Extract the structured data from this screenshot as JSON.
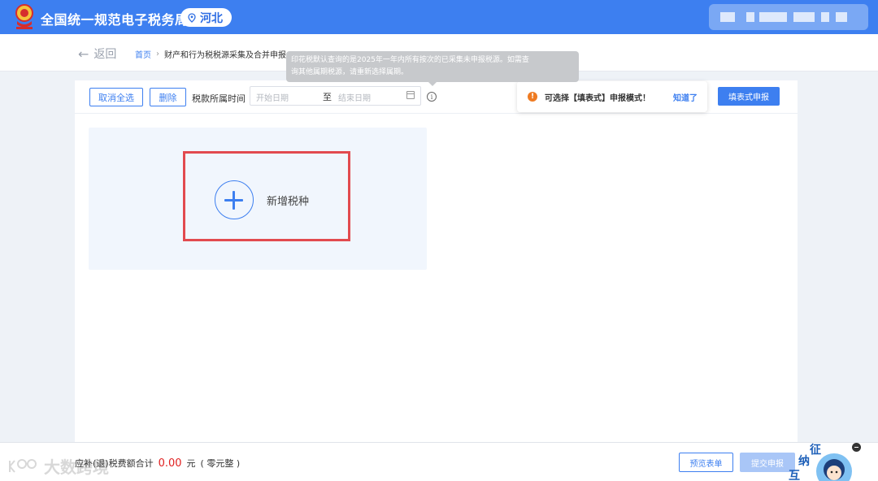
{
  "header": {
    "site_title": "全国统一规范电子税务局",
    "region": "河北"
  },
  "nav": {
    "back_label": "返回",
    "breadcrumb_home": "首页",
    "breadcrumb_sep": "›",
    "breadcrumb_current": "财产和行为税税源采集及合并申报"
  },
  "tooltip": {
    "line1": "印花税默认查询的是2025年一年内所有按次的已采集未申报税源。如需查",
    "line2": "询其他属期税源，请重新选择属期。"
  },
  "toolbar": {
    "deselect_all": "取消全选",
    "delete": "删除",
    "period_label": "税款所属时间",
    "start_placeholder": "开始日期",
    "to_label": "至",
    "end_placeholder": "结束日期",
    "info_glyph": "i",
    "notice_text": "可选择【填表式】申报模式！",
    "notice_ok": "知道了",
    "form_declare": "填表式申报"
  },
  "card": {
    "add_label": "新增税种"
  },
  "footer": {
    "watermark": "大数跨境",
    "total_label": "应补(退)税费额合计",
    "amount": "0.00",
    "unit": "元",
    "amount_words": "( 零元整 )",
    "preview": "预览表单",
    "submit": "提交申报"
  },
  "mascot": {
    "text1": "征",
    "text2": "纳",
    "text3": "互"
  },
  "colors": {
    "brand_blue": "#3d7ff0",
    "highlight_red": "#e24a4f",
    "amount_red": "#e02020",
    "warn_orange": "#ef7b22"
  }
}
